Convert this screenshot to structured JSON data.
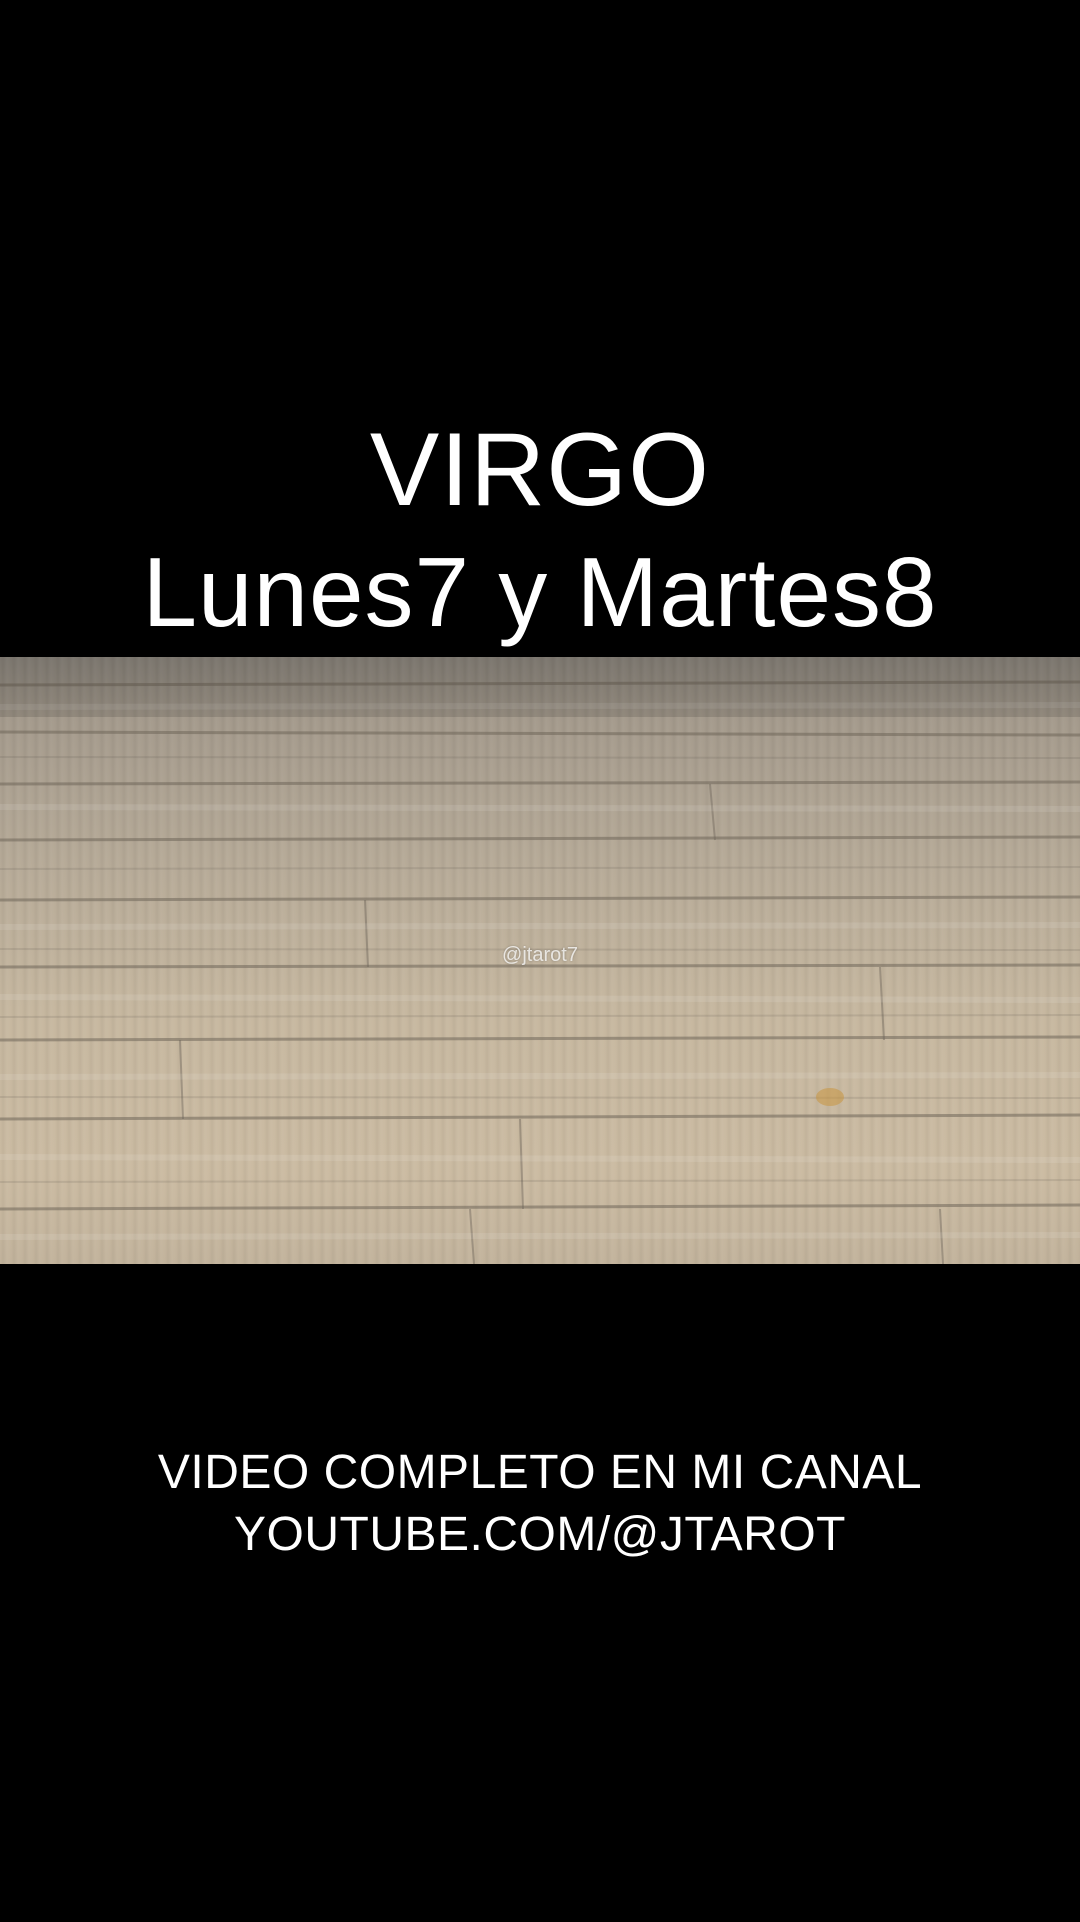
{
  "title": {
    "line1": "VIRGO",
    "line2": "Lunes7 y Martes8"
  },
  "video": {
    "watermark": "@jtarot7",
    "scene": "wooden-floor"
  },
  "footer": {
    "line1": "VIDEO COMPLETO EN MI CANAL",
    "line2": "YOUTUBE.COM/@JTAROT"
  },
  "colors": {
    "background": "#000000",
    "text": "#ffffff",
    "wood": "#c3b59d"
  }
}
